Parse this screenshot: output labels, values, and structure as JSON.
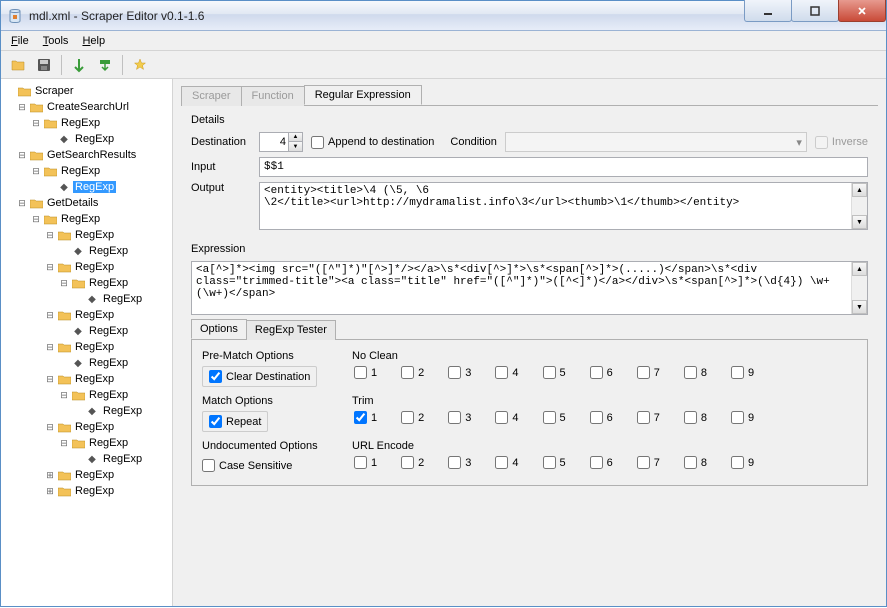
{
  "window": {
    "title": "mdl.xml - Scraper Editor v0.1-1.6"
  },
  "menu": {
    "file": "File",
    "tools": "Tools",
    "help": "Help"
  },
  "tree": {
    "root": "Scraper",
    "n1": "CreateSearchUrl",
    "n1a": "RegExp",
    "n1a1": "RegExp",
    "n2": "GetSearchResults",
    "n2a": "RegExp",
    "n2a1": "RegExp",
    "n3": "GetDetails",
    "n3a": "RegExp",
    "n3a1": "RegExp",
    "n3a1a": "RegExp",
    "n3a2": "RegExp",
    "n3a2a": "RegExp",
    "n3a2a1": "RegExp",
    "n3a3": "RegExp",
    "n3a3a": "RegExp",
    "n3a4": "RegExp",
    "n3a4a": "RegExp",
    "n3a5": "RegExp",
    "n3a5a": "RegExp",
    "n3a5a1": "RegExp",
    "n3a6": "RegExp",
    "n3a6a": "RegExp",
    "n3a6a1": "RegExp",
    "n3a7": "RegExp",
    "n3a8": "RegExp"
  },
  "tabs": {
    "scraper": "Scraper",
    "function": "Function",
    "regex": "Regular Expression"
  },
  "details": {
    "title": "Details",
    "destination_label": "Destination",
    "destination_value": "4",
    "append_label": "Append to destination",
    "condition_label": "Condition",
    "inverse_label": "Inverse",
    "input_label": "Input",
    "input_value": "$$1",
    "output_label": "Output",
    "output_value": "<entity><title>\\4 (\\5, \\6\n\\2</title><url>http://mydramalist.info\\3</url><thumb>\\1</thumb></entity>"
  },
  "expression": {
    "title": "Expression",
    "value": "<a[^>]*><img src=\"([^\"]*)\"[^>]*/></a>\\s*<div[^>]*>\\s*<span[^>]*>(.....)</span>\\s*<div class=\"trimmed-title\"><a class=\"title\" href=\"([^\"]*)\">([^<]*)</a></div>\\s*<span[^>]*>(\\d{4}) \\w+ (\\w+)</span>"
  },
  "inner_tabs": {
    "options": "Options",
    "tester": "RegExp Tester"
  },
  "options": {
    "prematch_title": "Pre-Match Options",
    "clear_dest": "Clear Destination",
    "noclean_title": "No Clean",
    "match_title": "Match Options",
    "repeat": "Repeat",
    "trim_title": "Trim",
    "undoc_title": "Undocumented Options",
    "case_sensitive": "Case Sensitive",
    "urlencode_title": "URL Encode",
    "n1": "1",
    "n2": "2",
    "n3": "3",
    "n4": "4",
    "n5": "5",
    "n6": "6",
    "n7": "7",
    "n8": "8",
    "n9": "9"
  }
}
